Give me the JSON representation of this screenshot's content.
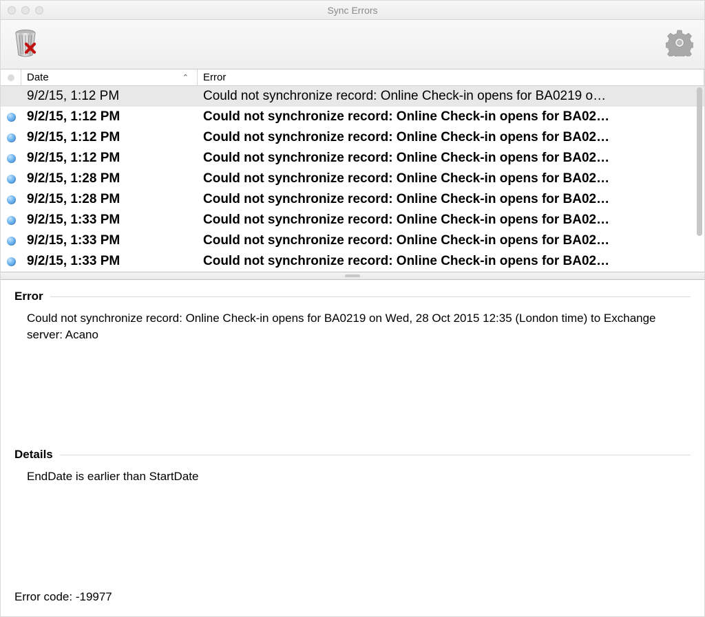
{
  "window": {
    "title": "Sync Errors"
  },
  "toolbar": {
    "trash_name": "delete-error-button",
    "gear_name": "settings-button"
  },
  "columns": {
    "date": "Date",
    "error": "Error"
  },
  "rows": [
    {
      "unread": false,
      "selected": true,
      "date": "9/2/15, 1:12 PM",
      "error": "Could not synchronize record: Online Check-in opens for BA0219 o…"
    },
    {
      "unread": true,
      "selected": false,
      "date": "9/2/15, 1:12 PM",
      "error": "Could not synchronize record: Online Check-in opens for BA02…"
    },
    {
      "unread": true,
      "selected": false,
      "date": "9/2/15, 1:12 PM",
      "error": "Could not synchronize record: Online Check-in opens for BA02…"
    },
    {
      "unread": true,
      "selected": false,
      "date": "9/2/15, 1:12 PM",
      "error": "Could not synchronize record: Online Check-in opens for BA02…"
    },
    {
      "unread": true,
      "selected": false,
      "date": "9/2/15, 1:28 PM",
      "error": "Could not synchronize record: Online Check-in opens for BA02…"
    },
    {
      "unread": true,
      "selected": false,
      "date": "9/2/15, 1:28 PM",
      "error": "Could not synchronize record: Online Check-in opens for BA02…"
    },
    {
      "unread": true,
      "selected": false,
      "date": "9/2/15, 1:33 PM",
      "error": "Could not synchronize record: Online Check-in opens for BA02…"
    },
    {
      "unread": true,
      "selected": false,
      "date": "9/2/15, 1:33 PM",
      "error": "Could not synchronize record: Online Check-in opens for BA02…"
    },
    {
      "unread": true,
      "selected": false,
      "date": "9/2/15, 1:33 PM",
      "error": "Could not synchronize record: Online Check-in opens for BA02…"
    }
  ],
  "detail": {
    "error_label": "Error",
    "error_body": "Could not synchronize record: Online Check-in opens for BA0219 on Wed, 28 Oct 2015 12:35 (London time) to Exchange server: Acano",
    "details_label": "Details",
    "details_body": "EndDate is earlier than StartDate",
    "errcode_label": "Error code:",
    "errcode_value": "-19977"
  }
}
